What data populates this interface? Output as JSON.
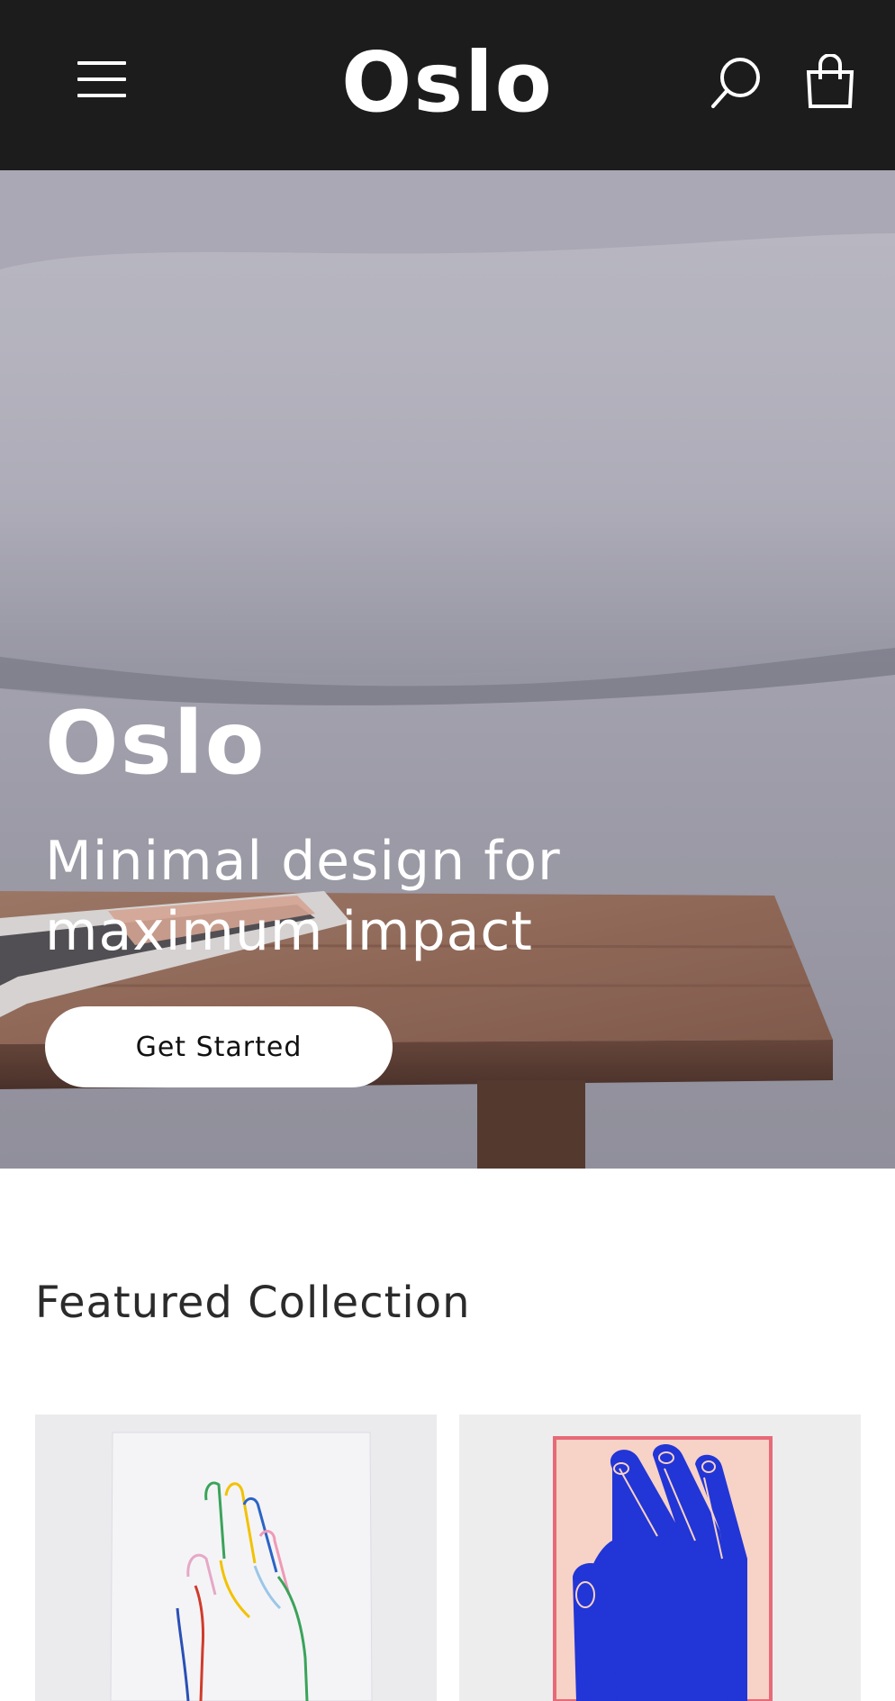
{
  "header": {
    "logo": "Oslo",
    "menu_icon": "hamburger-menu-icon",
    "search_icon": "search-icon",
    "cart_icon": "shopping-bag-icon",
    "background_color": "#1c1c1d"
  },
  "hero": {
    "title": "Oslo",
    "subtitle": "Minimal design for maximum impact",
    "cta_label": "Get Started"
  },
  "featured": {
    "title": "Featured Collection",
    "products": [
      {
        "icon": "hand-line-art-print-image"
      },
      {
        "icon": "blue-hands-framed-print-image"
      }
    ]
  }
}
